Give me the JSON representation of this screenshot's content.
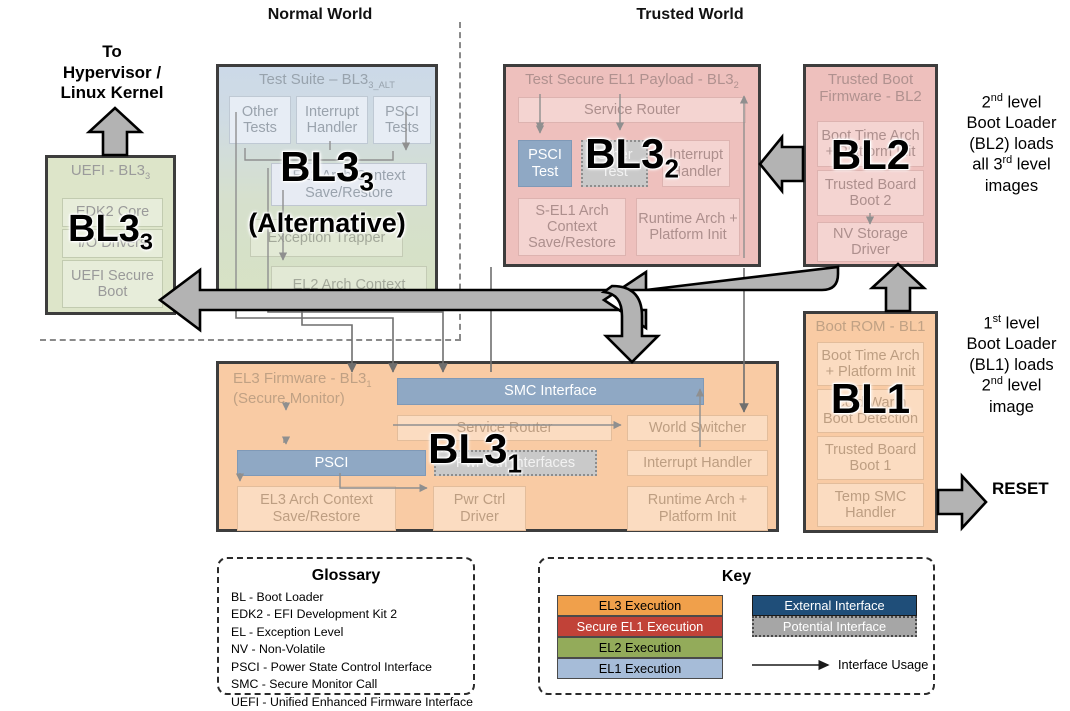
{
  "headers": {
    "normal_world": "Normal World",
    "trusted_world": "Trusted World"
  },
  "top_note": {
    "line1": "To",
    "line2": "Hypervisor /",
    "line3": "Linux Kernel"
  },
  "uefi": {
    "title": "UEFI - BL3",
    "title_sub": "3",
    "blocks": [
      "EDK2 Core",
      "I/O Drivers",
      "UEFI Secure Boot"
    ],
    "big_label": "BL3",
    "big_sub": "3"
  },
  "test_suite": {
    "title": "Test Suite – BL3",
    "title_sub": "3_ALT",
    "top_blocks": [
      "Other Tests",
      "Interrupt Handler",
      "PSCI Tests"
    ],
    "mid_blocks": [
      "EL1 Arch Context Save/Restore",
      "Exception Trapper",
      "EL2 Arch Context"
    ],
    "big_label": "BL3",
    "big_sub": "3",
    "big_note": "(Alternative)"
  },
  "tsp": {
    "title": "Test Secure EL1 Payload - BL3",
    "title_sub": "2",
    "service_router": "Service Router",
    "psci_test": "PSCI Test",
    "other_test": "Other Test",
    "interrupt_handler": "Interrupt Handler",
    "sel1_ctx": "S-EL1 Arch Context Save/Restore",
    "runtime": "Runtime Arch + Platform Init",
    "big_label": "BL3",
    "big_sub": "2"
  },
  "bl2": {
    "title": "Trusted Boot Firmware - BL2",
    "blocks": [
      "Boot Time Arch + Platform Init",
      "Trusted Board Boot 2",
      "NV Storage Driver"
    ],
    "big_label": "BL2"
  },
  "bl1": {
    "title": "Boot ROM - BL1",
    "blocks": [
      "Boot Time Arch + Platform Init",
      "Cold/Warm Boot Detection",
      "Trusted Board Boot 1",
      "Temp SMC Handler"
    ],
    "big_label": "BL1"
  },
  "el3": {
    "title_line1": "EL3 Firmware - BL3",
    "title_sub": "1",
    "title_line2": "(Secure Monitor)",
    "smc_interface": "SMC Interface",
    "service_router": "Service Router",
    "world_switcher": "World Switcher",
    "psci": "PSCI",
    "pwr_ctrl_interfaces": "Pwr Ctrl Interfaces",
    "interrupt_handler": "Interrupt Handler",
    "el3_ctx": "EL3 Arch Context Save/Restore",
    "pwr_ctrl_driver": "Pwr Ctrl Driver",
    "runtime": "Runtime Arch + Platform Init",
    "big_label": "BL3",
    "big_sub": "1"
  },
  "annotations": {
    "bl2_note": {
      "l1_a": "2",
      "l1_sup": "nd",
      "l1_b": " level",
      "l2": "Boot Loader",
      "l3": "(BL2) loads",
      "l4_a": "all 3",
      "l4_sup": "rd",
      "l4_b": " level",
      "l5": "images"
    },
    "bl1_note": {
      "l1_a": "1",
      "l1_sup": "st",
      "l1_b": " level",
      "l2": "Boot Loader",
      "l3": "(BL1) loads",
      "l4_a": "2",
      "l4_sup": "nd",
      "l4_b": " level",
      "l5": "image"
    },
    "reset": "RESET"
  },
  "glossary": {
    "title": "Glossary",
    "entries": [
      "BL - Boot Loader",
      "EDK2 - EFI Development Kit 2",
      "EL - Exception Level",
      "NV - Non-Volatile",
      "PSCI - Power State Control Interface",
      "SMC - Secure Monitor Call",
      "UEFI - Unified Enhanced Firmware Interface"
    ]
  },
  "key": {
    "title": "Key",
    "exec_levels": [
      "EL3 Execution",
      "Secure EL1 Execution",
      "EL2 Execution",
      "EL1 Execution"
    ],
    "interfaces": [
      "External Interface",
      "Potential Interface"
    ],
    "usage_label": "Interface Usage"
  },
  "colors": {
    "el3_exec": "#f0a04b",
    "secure_el1_exec": "#c14238",
    "el2_exec": "#93ab5a",
    "el1_exec": "#a6bcd8",
    "external_interface": "#1f4e79",
    "potential_interface": "#a6a6a6",
    "green_module": "#dde5c9",
    "salmon_module": "#eec0bd",
    "peach_module": "#f9cba4",
    "fat_arrow": "#b3b3b3"
  }
}
